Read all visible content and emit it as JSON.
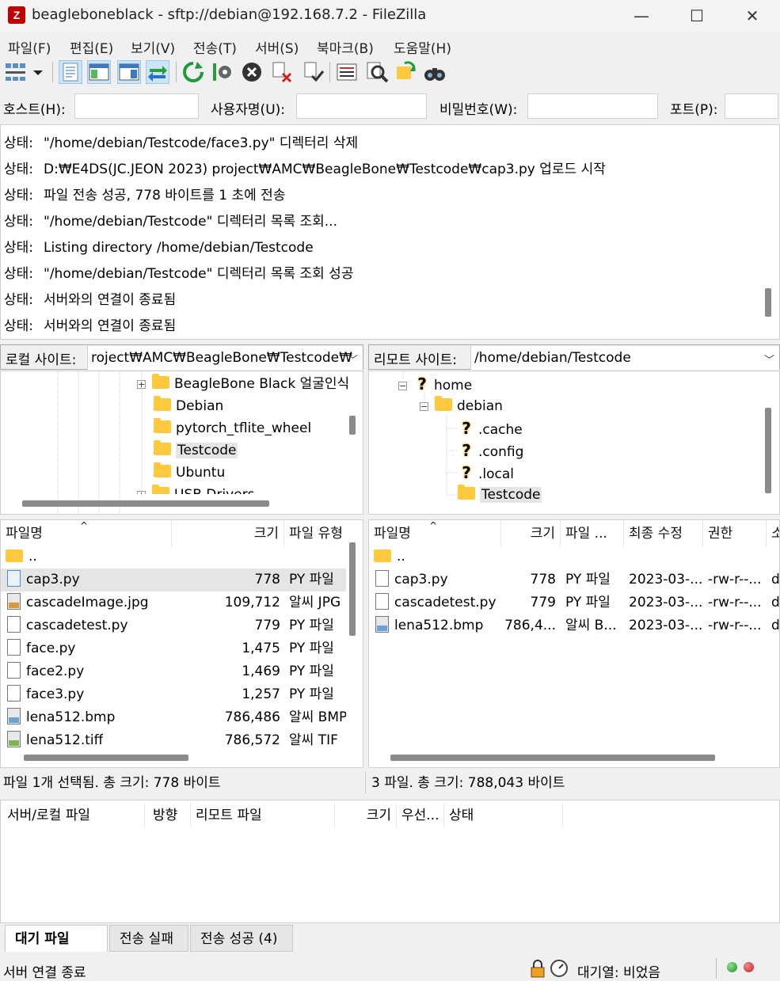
{
  "window": {
    "app_icon": "Z",
    "title": "beagleboneblack - sftp://debian@192.168.7.2 - FileZilla",
    "controls": {
      "minimize": "—",
      "maximize": "☐",
      "close": "✕"
    }
  },
  "menu": [
    "파일(F)",
    "편집(E)",
    "보기(V)",
    "전송(T)",
    "서버(S)",
    "북마크(B)",
    "도움말(H)"
  ],
  "toolbar_icons": [
    "site-manager-icon",
    "dropdown-arrow-icon",
    "toggle-message-log-icon",
    "toggle-local-tree-icon",
    "toggle-remote-tree-icon",
    "toggle-transfer-queue-icon",
    "refresh-icon",
    "process-queue-icon",
    "cancel-icon",
    "disconnect-icon",
    "reconnect-icon",
    "directory-listing-filters-icon",
    "compare-icon",
    "sync-browse-icon",
    "search-icon"
  ],
  "quickconnect": {
    "host_label": "호스트(H):",
    "user_label": "사용자명(U):",
    "pass_label": "비밀번호(W):",
    "port_label": "포트(P):",
    "host_value": "",
    "user_value": "",
    "pass_value": "",
    "port_value": ""
  },
  "log": [
    {
      "tag": "상태:",
      "text": "\"/home/debian/Testcode/face3.py\" 디렉터리 삭제"
    },
    {
      "tag": "상태:",
      "text": "D:₩E4DS(JC.JEON 2023) project₩AMC₩BeagleBone₩Testcode₩cap3.py 업로드 시작"
    },
    {
      "tag": "상태:",
      "text": "파일 전송 성공, 778 바이트를 1 초에 전송"
    },
    {
      "tag": "상태:",
      "text": "\"/home/debian/Testcode\" 디렉터리 목록 조회..."
    },
    {
      "tag": "상태:",
      "text": "Listing directory /home/debian/Testcode"
    },
    {
      "tag": "상태:",
      "text": "\"/home/debian/Testcode\" 디렉터리 목록 조회 성공"
    },
    {
      "tag": "상태:",
      "text": "서버와의 연결이 종료됨"
    },
    {
      "tag": "상태:",
      "text": "서버와의 연결이 종료됨"
    }
  ],
  "local": {
    "site_label": "로컬 사이트:",
    "path": "roject₩AMC₩BeagleBone₩Testcode₩",
    "tree": [
      {
        "label": "BeagleBone Black 얼굴인식",
        "expander": "+"
      },
      {
        "label": "Debian"
      },
      {
        "label": "pytorch_tflite_wheel"
      },
      {
        "label": "Testcode",
        "selected": true
      },
      {
        "label": "Ubuntu"
      },
      {
        "label": "USB Drivers",
        "expander": "+"
      }
    ],
    "columns": [
      "파일명",
      "크기",
      "파일 유형"
    ],
    "files": [
      {
        "name": "..",
        "size": "",
        "type": "",
        "icon": "folder"
      },
      {
        "name": "cap3.py",
        "size": "778",
        "type": "PY 파일",
        "icon": "py",
        "selected": true
      },
      {
        "name": "cascadeImage.jpg",
        "size": "109,712",
        "type": "알씨 JPG",
        "icon": "jpg"
      },
      {
        "name": "cascadetest.py",
        "size": "779",
        "type": "PY 파일",
        "icon": "py"
      },
      {
        "name": "face.py",
        "size": "1,475",
        "type": "PY 파일",
        "icon": "py"
      },
      {
        "name": "face2.py",
        "size": "1,469",
        "type": "PY 파일",
        "icon": "py"
      },
      {
        "name": "face3.py",
        "size": "1,257",
        "type": "PY 파일",
        "icon": "py"
      },
      {
        "name": "lena512.bmp",
        "size": "786,486",
        "type": "알씨 BMP",
        "icon": "bmp"
      },
      {
        "name": "lena512.tiff",
        "size": "786,572",
        "type": "알씨 TIF",
        "icon": "tif"
      }
    ],
    "status": "파일 1개 선택됨. 총 크기: 778 바이트"
  },
  "remote": {
    "site_label": "리모트 사이트:",
    "path": "/home/debian/Testcode",
    "tree": [
      {
        "label": "home",
        "icon": "question",
        "expander": "−"
      },
      {
        "label": "debian",
        "icon": "folder",
        "expander": "−"
      },
      {
        "label": ".cache",
        "icon": "question"
      },
      {
        "label": ".config",
        "icon": "question"
      },
      {
        "label": ".local",
        "icon": "question"
      },
      {
        "label": "Testcode",
        "icon": "folder",
        "selected": true
      }
    ],
    "columns": [
      "파일명",
      "크기",
      "파일 ...",
      "최종 수정",
      "권한",
      "소"
    ],
    "files": [
      {
        "name": "..",
        "size": "",
        "type": "",
        "modified": "",
        "perm": "",
        "owner": "",
        "icon": "folder"
      },
      {
        "name": "cap3.py",
        "size": "778",
        "type": "PY 파일",
        "modified": "2023-03-...",
        "perm": "-rw-r--...",
        "owner": "d",
        "icon": "py"
      },
      {
        "name": "cascadetest.py",
        "size": "779",
        "type": "PY 파일",
        "modified": "2023-03-...",
        "perm": "-rw-r--...",
        "owner": "d",
        "icon": "py"
      },
      {
        "name": "lena512.bmp",
        "size": "786,4...",
        "type": "알씨 B...",
        "modified": "2023-03-...",
        "perm": "-rw-r--...",
        "owner": "d",
        "icon": "bmp"
      }
    ],
    "status": "3 파일. 총 크기: 788,043 바이트"
  },
  "queue": {
    "columns": [
      "서버/로컬 파일",
      "방향",
      "리모트 파일",
      "크기",
      "우선...",
      "상태"
    ],
    "tabs": [
      "대기 파일",
      "전송 실패",
      "전송 성공 (4)"
    ]
  },
  "statusbar": {
    "left": "서버 연결 종료",
    "queue": "대기열: 비었음",
    "icons": [
      "lock-icon",
      "speed-limit-icon"
    ],
    "lights": {
      "receive": "#1e8a1e",
      "send": "#c81e1e"
    }
  }
}
